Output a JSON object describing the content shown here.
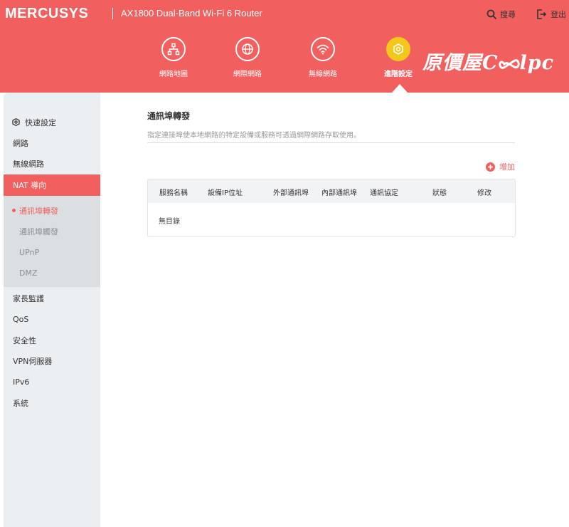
{
  "header": {
    "brand": "MERCUSYS",
    "model": "AX1800 Dual-Band Wi-Fi 6 Router",
    "search_label": "搜尋",
    "logout_label": "登出",
    "bg_color": "#f25f5f"
  },
  "nav": {
    "items": [
      {
        "label": "網路地圖",
        "icon": "network-map-icon"
      },
      {
        "label": "網際網路",
        "icon": "globe-icon"
      },
      {
        "label": "無線網路",
        "icon": "wifi-icon"
      },
      {
        "label": "進階設定",
        "icon": "advanced-gear-icon",
        "active": true
      }
    ]
  },
  "watermark": {
    "text_left": "原價屋C",
    "text_right": "lpc"
  },
  "sidebar": {
    "quick_setup": "快速設定",
    "items_top": [
      "網路",
      "無線網路"
    ],
    "nat": "NAT 導向",
    "sub_items": [
      "通訊埠轉發",
      "通訊埠觸發",
      "UPnP",
      "DMZ"
    ],
    "active_sub": "通訊埠轉發",
    "items_bottom": [
      "家長監護",
      "QoS",
      "安全性",
      "VPN伺服器",
      "IPv6",
      "系統"
    ]
  },
  "main": {
    "title": "通訊埠轉發",
    "description": "指定連接埠使本地網路的特定設備或服務可透過網際網路存取使用。",
    "add_label": "增加",
    "table": {
      "columns": [
        "服務名稱",
        "設備IP位址",
        "外部通訊埠",
        "內部通訊埠",
        "通訊協定",
        "狀態",
        "修改"
      ],
      "empty_text": "無目錄"
    }
  },
  "colors": {
    "accent": "#f25f5f",
    "active_nav": "#f4c81a"
  }
}
